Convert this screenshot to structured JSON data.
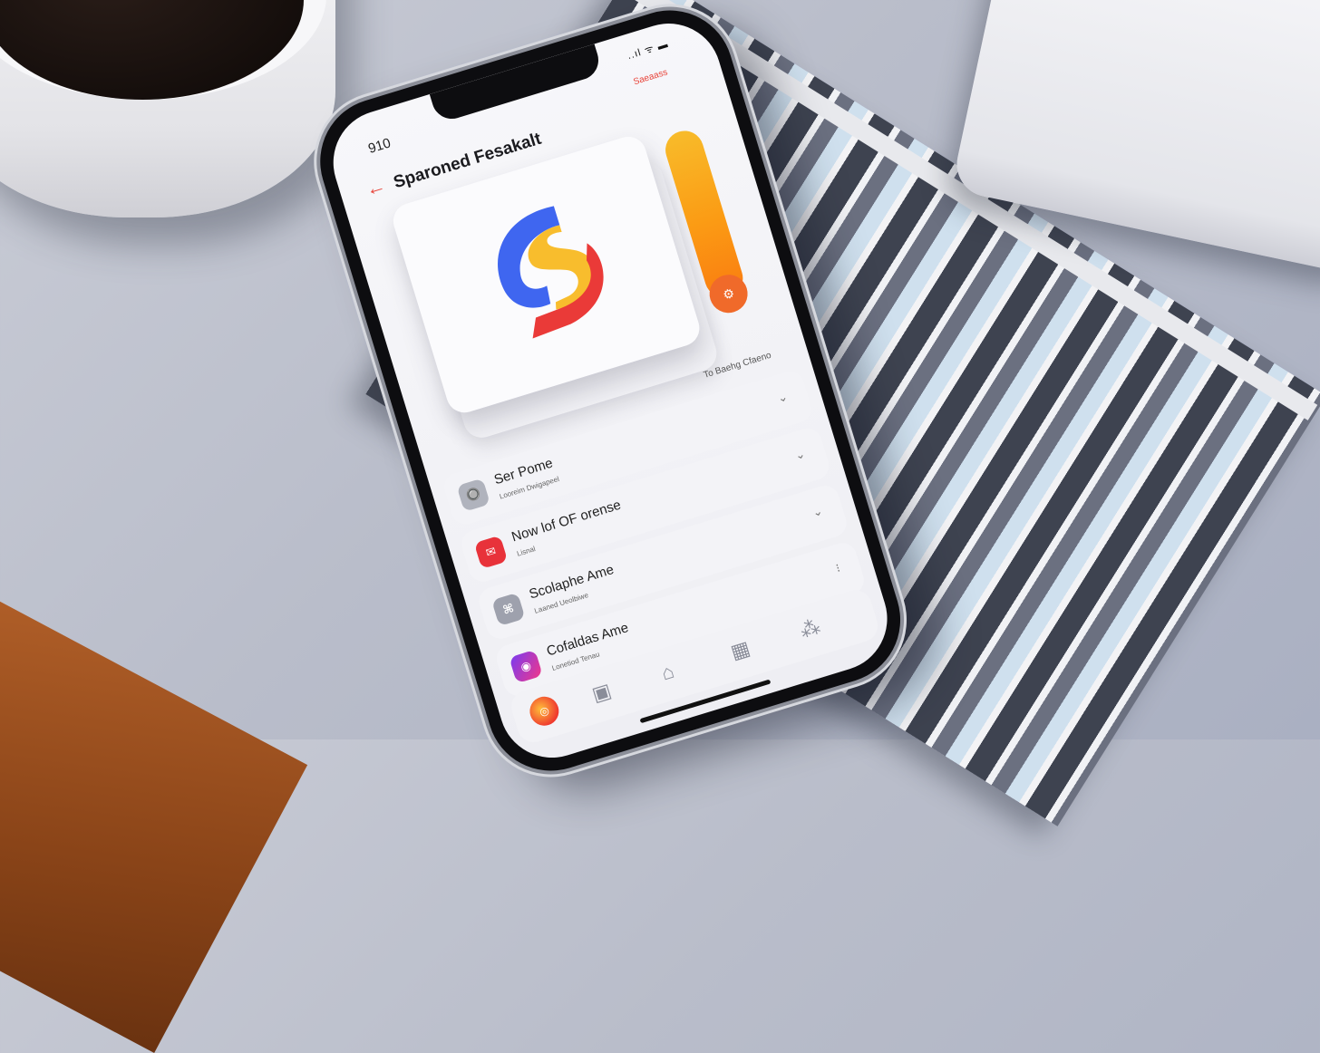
{
  "status": {
    "time": "910",
    "signal": "..ıl ᯤ ▬"
  },
  "header": {
    "back_glyph": "←",
    "title": "Sparoned Fesakalt",
    "top_action": "Saeaass"
  },
  "hero": {
    "logo_letter": "S"
  },
  "gauge": {
    "button_glyph": "⚙"
  },
  "section_hint": "To Baehg Cfaeno",
  "list": [
    {
      "icon": "🔘",
      "title": "Ser Pome",
      "subtitle": "Looreim Dwigapeel",
      "color": "#b0b3bd"
    },
    {
      "icon": "✉",
      "title": "Now lof OF orense",
      "subtitle": "Lisnal",
      "color": "#e8323a"
    },
    {
      "icon": "⌘",
      "title": "Scolaphe Ame",
      "subtitle": "Laaned Ueolbiwe",
      "color": "#9ea1ad"
    },
    {
      "icon": "◉",
      "title": "Cofaldas Ame",
      "subtitle": "Lonetiod Tenau",
      "color": "#c234c6"
    }
  ],
  "tabbar": {
    "active_icon": "◎",
    "tabs": [
      "▣",
      "⌂",
      "▦",
      "⁂"
    ]
  }
}
